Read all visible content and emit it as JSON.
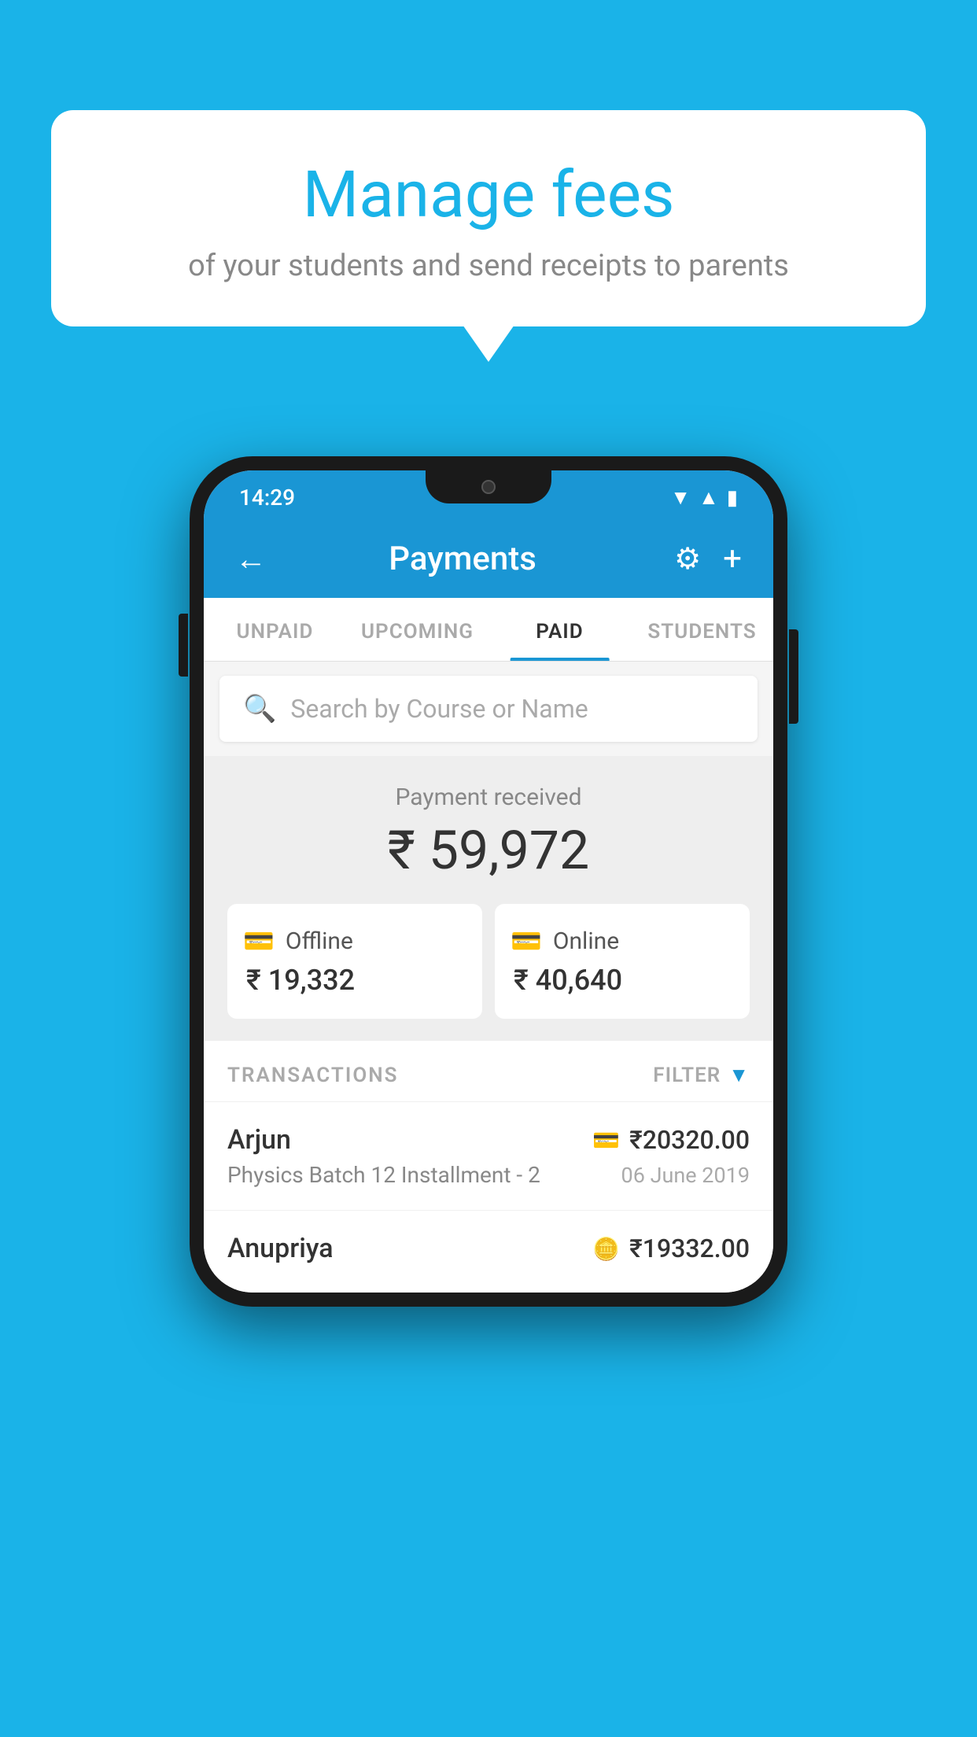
{
  "background_color": "#1ab3e8",
  "bubble": {
    "title": "Manage fees",
    "subtitle": "of your students and send receipts to parents"
  },
  "phone": {
    "status_bar": {
      "time": "14:29",
      "wifi": "▲",
      "signal": "▲",
      "battery": "▮"
    },
    "header": {
      "back_icon": "←",
      "title": "Payments",
      "settings_icon": "⚙",
      "add_icon": "+"
    },
    "tabs": [
      {
        "label": "UNPAID",
        "active": false
      },
      {
        "label": "UPCOMING",
        "active": false
      },
      {
        "label": "PAID",
        "active": true
      },
      {
        "label": "STUDENTS",
        "active": false
      }
    ],
    "search": {
      "placeholder": "Search by Course or Name"
    },
    "payment_summary": {
      "label": "Payment received",
      "amount": "₹ 59,972",
      "offline": {
        "label": "Offline",
        "amount": "₹ 19,332"
      },
      "online": {
        "label": "Online",
        "amount": "₹ 40,640"
      }
    },
    "transactions": {
      "header": "TRANSACTIONS",
      "filter_label": "FILTER",
      "rows": [
        {
          "name": "Arjun",
          "course": "Physics Batch 12 Installment - 2",
          "amount": "₹20320.00",
          "date": "06 June 2019",
          "icon": "card"
        },
        {
          "name": "Anupriya",
          "course": "",
          "amount": "₹19332.00",
          "date": "",
          "icon": "cash"
        }
      ]
    }
  }
}
